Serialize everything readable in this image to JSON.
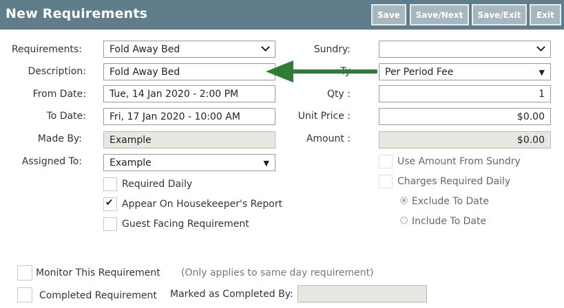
{
  "header": {
    "title": "New Requirements",
    "buttons": {
      "save": "Save",
      "save_next": "Save/Next",
      "save_exit": "Save/Exit",
      "exit": "Exit"
    }
  },
  "left": {
    "requirements": {
      "label": "Requirements:",
      "value": "Fold Away Bed"
    },
    "description": {
      "label": "Description:",
      "value": "Fold Away Bed"
    },
    "from_date": {
      "label": "From Date:",
      "value": "Tue, 14 Jan 2020 - 2:00 PM"
    },
    "to_date": {
      "label": "To Date:",
      "value": "Fri, 17 Jan 2020 - 10:00 AM"
    },
    "made_by": {
      "label": "Made By:",
      "value": "Example"
    },
    "assigned_to": {
      "label": "Assigned To:",
      "value": "Example"
    },
    "checkboxes": {
      "required_daily": {
        "label": "Required Daily",
        "checked": false
      },
      "housekeeper_report": {
        "label": "Appear On Housekeeper's Report",
        "checked": true
      },
      "guest_facing": {
        "label": "Guest Facing Requirement",
        "checked": false
      }
    }
  },
  "right": {
    "sundry": {
      "label": "Sundry:",
      "value": ""
    },
    "type": {
      "label_partial": "Ty",
      "value": "Per Period Fee"
    },
    "qty": {
      "label": "Qty :",
      "value": "1"
    },
    "unit_price": {
      "label": "Unit Price :",
      "value": "$0.00"
    },
    "amount": {
      "label": "Amount :",
      "value": "$0.00"
    },
    "use_amount_from_sundry": "Use Amount From Sundry",
    "charges_required_daily": "Charges Required Daily",
    "exclude_to_date": "Exclude To Date",
    "include_to_date": "Include To Date"
  },
  "bottom": {
    "monitor": "Monitor This Requirement",
    "monitor_note": "(Only applies to same day requirement)",
    "completed": "Completed Requirement",
    "marked_completed_by": "Marked as Completed By:",
    "marked_completed_by_value": ""
  },
  "colors": {
    "header": "#607d8b",
    "arrow": "#2e7d32"
  }
}
